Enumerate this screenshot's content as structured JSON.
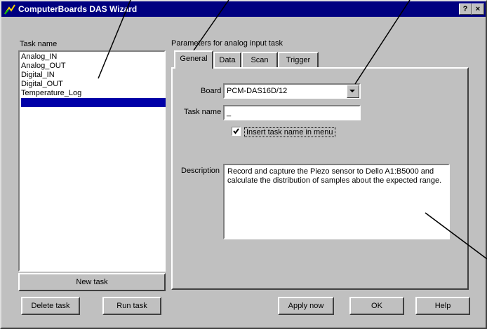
{
  "window": {
    "title": "ComputerBoards DAS Wizard",
    "help_button": "?",
    "close_button": "×"
  },
  "task_list": {
    "label": "Task name",
    "items": [
      "Analog_IN",
      "Analog_OUT",
      "Digital_IN",
      "Digital_OUT",
      "Temperature_Log",
      ""
    ],
    "selected_index": 5
  },
  "buttons": {
    "new_task": "New task",
    "delete_task": "Delete task",
    "run_task": "Run task",
    "apply_now": "Apply now",
    "ok": "OK",
    "help": "Help"
  },
  "params": {
    "group_label": "Parameters for analog input task",
    "tabs": [
      "General",
      "Data",
      "Scan",
      "Trigger"
    ],
    "active_tab": "General",
    "board_label": "Board",
    "board_value": "PCM-DAS16D/12",
    "task_name_label": "Task name",
    "task_name_value": "_",
    "insert_checkbox_label": "Insert task name in menu",
    "insert_checked": true,
    "description_label": "Description",
    "description_text": "Record and capture the Piezo sensor to Dello A1:B5000 and calculate the distribution of samples about the expected range."
  },
  "colors": {
    "face": "#c0c0c0",
    "title_bar": "#000080",
    "selection": "#0000a8"
  }
}
